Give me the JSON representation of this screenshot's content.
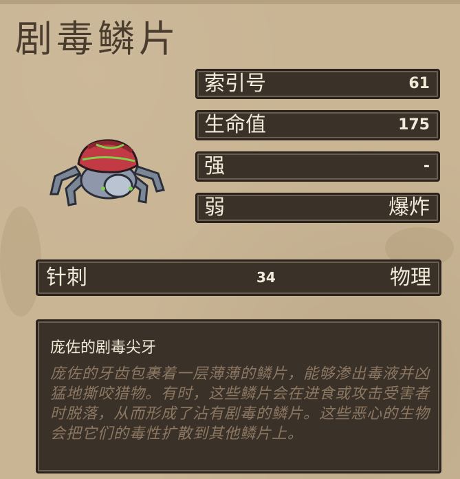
{
  "title": "剧毒鳞片",
  "stats": [
    {
      "label": "索引号",
      "value": "61"
    },
    {
      "label": "生命值",
      "value": "175"
    },
    {
      "label": "强",
      "value": "-"
    },
    {
      "label": "弱",
      "value": "爆炸"
    }
  ],
  "attack": {
    "name": "针刺",
    "damage": "34",
    "type": "物理"
  },
  "description": {
    "title": "庞佐的剧毒尖牙",
    "body": "庞佐的牙齿包裹着一层薄薄的鳞片，能够渗出毒液并凶猛地撕咬猎物。有时，这些鳞片会在进食或攻击受害者时脱落，从而形成了沾有剧毒的鳞片。这些恶心的生物会把它们的毒性扩散到其他鳞片上。"
  },
  "colors": {
    "parchment": "#c9b594",
    "panel": "#3a3129",
    "panel_text": "#f3ead9",
    "desc_text": "#8c7862",
    "title_text": "#4a3d2d"
  }
}
